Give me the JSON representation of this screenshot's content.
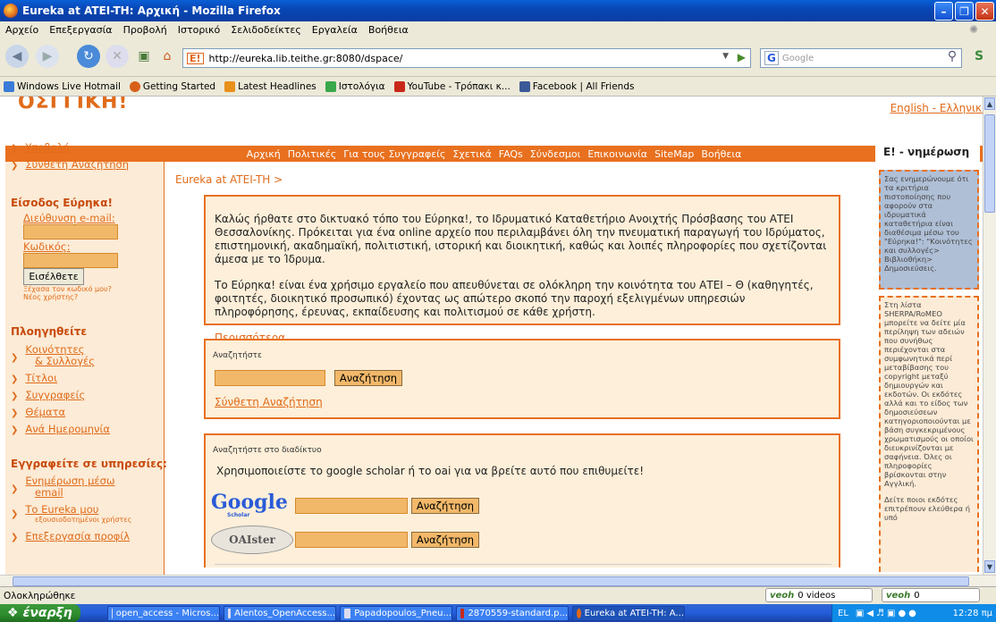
{
  "window": {
    "title": "Eureka at ATEI-TH: Αρχική - Mozilla Firefox"
  },
  "menu": [
    "Αρχείο",
    "Επεξεργασία",
    "Προβολή",
    "Ιστορικό",
    "Σελιδοδείκτες",
    "Εργαλεία",
    "Βοήθεια"
  ],
  "address": {
    "url": "http://eureka.lib.teithe.gr:8080/dspace/",
    "search_placeholder": "Google",
    "search_engine": "G"
  },
  "bookmarks": [
    "Windows Live Hotmail",
    "Getting Started",
    "Latest Headlines",
    "Ιστολόγια",
    "YouTube - Τρόπακι κ...",
    "Facebook | All Friends"
  ],
  "page": {
    "logo": "ΟΣΓΓΙΚΗ!",
    "langs": "English - Ελληνικά",
    "nav": [
      "Αρχική",
      "Πολιτικές",
      "Για τους Συγγραφείς",
      "Σχετικά",
      "FAQs",
      "Σύνδεσμοι",
      "Επικοινωνία",
      "SiteMap",
      "Βοήθεια"
    ],
    "left": {
      "submit": "Υποβολή",
      "advanced": "Σύνθετη Αναζήτηση",
      "login_title": "Είσοδος Εύρηκα!",
      "email_label": "Διεύθυνση e-mail:",
      "password_label": "Κωδικός:",
      "login_button": "Εισέλθετε",
      "forgot": "Ξέχασα τον κωδικό μου?",
      "new_user": "Νέος χρήστης?",
      "browse_title": "Πλοηγηθείτε",
      "browse_items": [
        "Κοινότητες",
        "& Συλλογές",
        "Τίτλοι",
        "Συγγραφείς",
        "Θέματα",
        "Ανά Ημερομηνία"
      ],
      "subscribe_title": "Εγγραφείτε σε υπηρεσίες:",
      "sub_email": "Ενημέρωση μέσω",
      "sub_email2": "email",
      "sub_myeureka": "Το Eureka μου",
      "sub_myeureka_note": "εξουσιοδοτημένοι χρήστες",
      "sub_profile": "Επεξεργασία προφίλ"
    },
    "breadcrumb": "Eureka at ATEI-TH >",
    "welcome": {
      "p1": "Καλώς ήρθατε στο δικτυακό τόπο του Εύρηκα!, το Ιδρυματικό Καταθετήριο Ανοιχτής Πρόσβασης του ΑΤΕΙ Θεσσαλονίκης. Πρόκειται για ένα online αρχείο που περιλαμβάνει όλη την πνευματική παραγωγή του Ιδρύματος, επιστημονική, ακαδημαϊκή, πολιτιστική, ιστορική και διοικητική, καθώς και λοιπές πληροφορίες που σχετίζονται άμεσα με το Ίδρυμα.",
      "p2": "Το Εύρηκα! είναι ένα χρήσιμο εργαλείο που απευθύνεται σε ολόκληρη την κοινότητα του ΑΤΕΙ – Θ (καθηγητές, φοιτητές, διοικητικό προσωπικό) έχοντας ως απώτερο σκοπό την παροχή εξελιγμένων υπηρεσιών πληροφόρησης, έρευνας, εκπαίδευσης και πολιτισμού σε κάθε χρήστη.",
      "more": "Περισσότερα..."
    },
    "search": {
      "label": "Αναζητήστε",
      "button": "Αναζήτηση",
      "advanced": "Σύνθετη Αναζήτηση"
    },
    "web": {
      "label": "Αναζητήστε στο διαδίκτυο",
      "desc": "Χρησιμοποιείστε το google scholar ή το oai για να βρείτε αυτό που επιθυμείτε!",
      "google_logo": "Google",
      "google_sub": "Scholar",
      "oaister_logo": "OAIster",
      "button": "Αναζήτηση"
    },
    "right": {
      "title": "Ε! - νημέρωση",
      "box1": "Σας ενημερώνουμε ότι τα κριτήρια πιστοποίησης που αφορούν στα ιδρυματικά καταθετήρια είναι διαθέσιμα μέσω του \"Εύρηκα!\": \"Κοινότητες και συλλογές> Βιβλιοθήκη> Δημοσιεύσεις.",
      "box2": "Στη λίστα SHERPA/RoMEO μπορείτε να δείτε μία περίληψη των αδειών που συνήθως περιέχονται στα συμφωνητικά περί μεταβίβασης του copyright μεταξύ δημιουργών και εκδοτών. Οι εκδότες αλλά και το είδος των δημοσιεύσεων κατηγοριοποιούνται με βάση συγκεκριμένους χρωματισμούς οι οποίοι διευκρινίζονται με σαφήνεια. Όλες οι πληροφορίες βρίσκονται στην Αγγλική.",
      "box3": "Δείτε ποιοι εκδότες επιτρέπουν ελεύθερα ή υπό"
    }
  },
  "status": {
    "text": "Ολοκληρώθηκε",
    "veoh1": "0 videos",
    "veoh2": "0"
  },
  "taskbar": {
    "start": "έναρξη",
    "items": [
      "open_access - Micros...",
      "Alentos_OpenAccess...",
      "Papadopoulos_Pneu...",
      "2870559-standard.p...",
      "Eureka at ATEI-TH: A..."
    ],
    "lang": "EL",
    "clock": "12:28 πμ"
  }
}
